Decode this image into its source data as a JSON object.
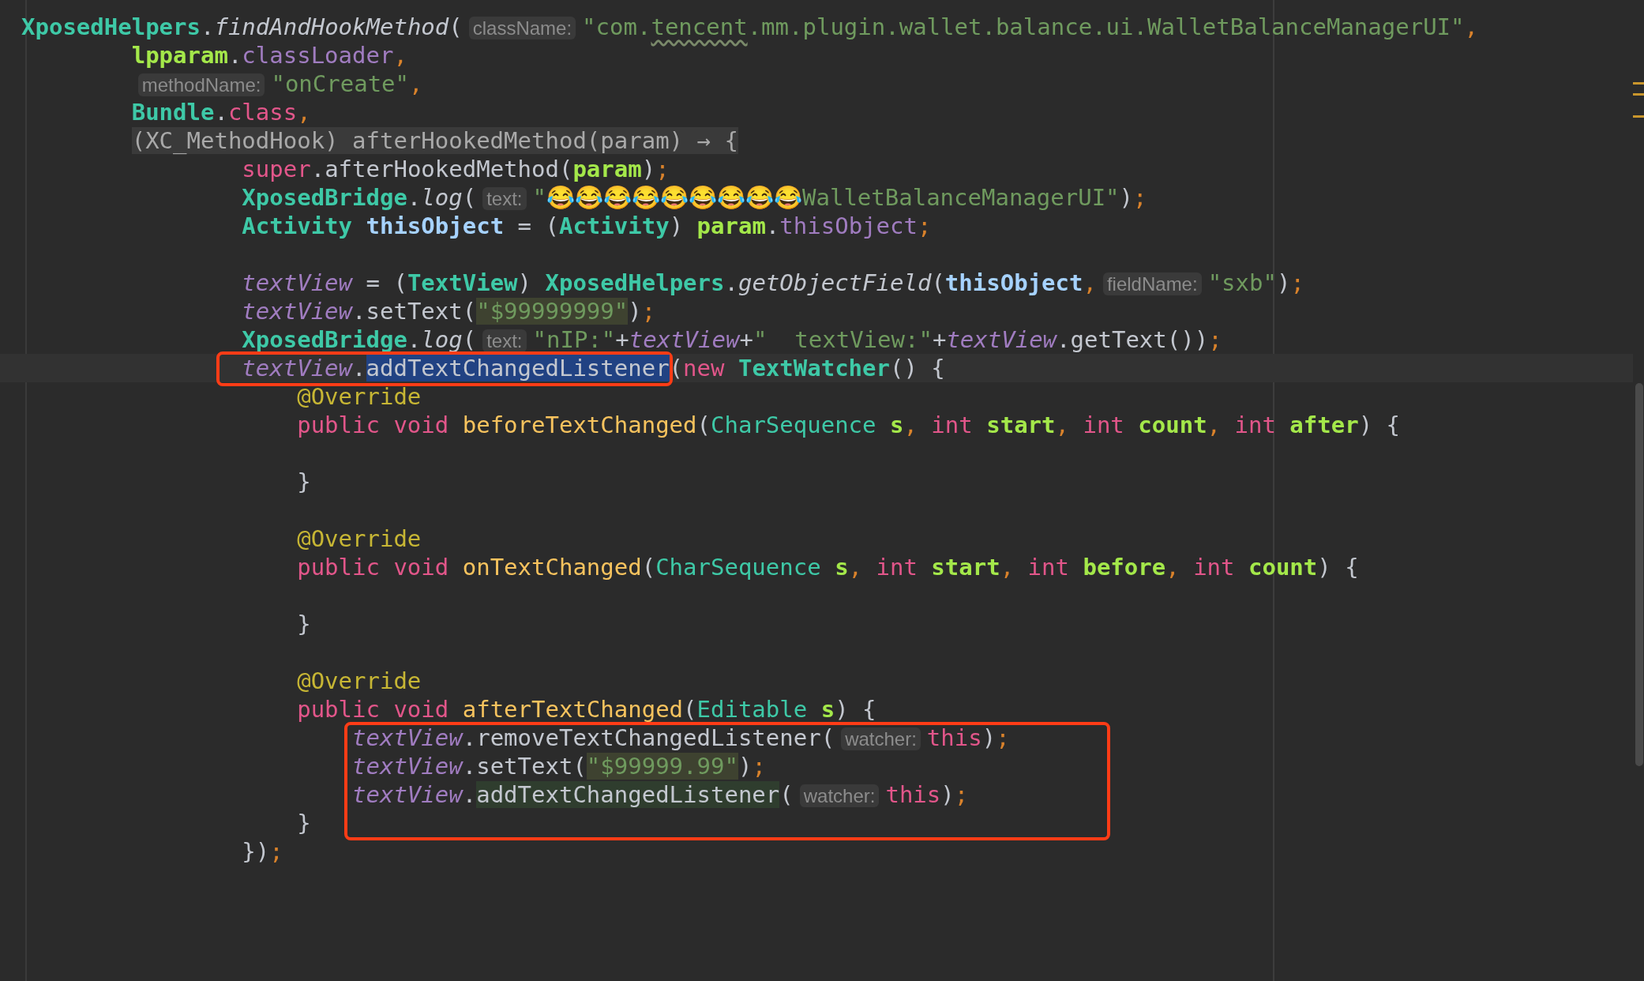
{
  "editor": {
    "lines": [
      {
        "kind": "line",
        "tokens": [
          {
            "kind": "class",
            "text": "XposedHelpers"
          },
          {
            "kind": "punct",
            "text": "."
          },
          {
            "kind": "static-call",
            "text": "findAndHookMethod"
          },
          {
            "kind": "punct",
            "text": "("
          },
          {
            "kind": "hint",
            "text": "className:"
          },
          {
            "kind": "string",
            "text": "\"com."
          },
          {
            "kind": "string-typo",
            "text": "tencent"
          },
          {
            "kind": "string",
            "text": ".mm.plugin.wallet.balance.ui.WalletBalanceManagerUI\""
          },
          {
            "kind": "sep",
            "text": ","
          }
        ],
        "children": [
          {
            "kind": "line",
            "tokens": [
              {
                "kind": "param",
                "text": "lpparam"
              },
              {
                "kind": "punct",
                "text": "."
              },
              {
                "kind": "field",
                "text": "classLoader"
              },
              {
                "kind": "sep",
                "text": ","
              }
            ]
          },
          {
            "kind": "line",
            "tokens": [
              {
                "kind": "hint",
                "text": "methodName:"
              },
              {
                "kind": "string",
                "text": "\"onCreate\""
              },
              {
                "kind": "sep",
                "text": ","
              }
            ]
          },
          {
            "kind": "line",
            "tokens": [
              {
                "kind": "class",
                "text": "Bundle"
              },
              {
                "kind": "punct",
                "text": "."
              },
              {
                "kind": "keyword",
                "text": "class"
              },
              {
                "kind": "sep",
                "text": ","
              }
            ]
          },
          {
            "kind": "line",
            "tokens": [
              {
                "kind": "folded",
                "text": "(XC_MethodHook) afterHookedMethod(param) → {"
              }
            ],
            "children": [
              {
                "kind": "line",
                "tokens": [
                  {
                    "kind": "keyword",
                    "text": "super"
                  },
                  {
                    "kind": "punct",
                    "text": "."
                  },
                  {
                    "kind": "call",
                    "text": "afterHookedMethod"
                  },
                  {
                    "kind": "punct",
                    "text": "("
                  },
                  {
                    "kind": "param",
                    "text": "param"
                  },
                  {
                    "kind": "punct",
                    "text": ")"
                  },
                  {
                    "kind": "sep",
                    "text": ";"
                  }
                ]
              },
              {
                "kind": "line",
                "tokens": [
                  {
                    "kind": "class",
                    "text": "XposedBridge"
                  },
                  {
                    "kind": "punct",
                    "text": "."
                  },
                  {
                    "kind": "static-call",
                    "text": "log"
                  },
                  {
                    "kind": "punct",
                    "text": "("
                  },
                  {
                    "kind": "hint",
                    "text": "text:"
                  },
                  {
                    "kind": "string",
                    "text": "\"😂😂😂😂😂😂😂😂😂WalletBalanceManagerUI\""
                  },
                  {
                    "kind": "punct",
                    "text": ")"
                  },
                  {
                    "kind": "sep",
                    "text": ";"
                  }
                ]
              },
              {
                "kind": "line",
                "tokens": [
                  {
                    "kind": "class",
                    "text": "Activity"
                  },
                  {
                    "kind": "local",
                    "text": " thisObject"
                  },
                  {
                    "kind": "punct",
                    "text": " = ("
                  },
                  {
                    "kind": "class",
                    "text": "Activity"
                  },
                  {
                    "kind": "punct",
                    "text": ")"
                  },
                  {
                    "kind": "param",
                    "text": " param"
                  },
                  {
                    "kind": "punct",
                    "text": "."
                  },
                  {
                    "kind": "field",
                    "text": "thisObject"
                  },
                  {
                    "kind": "sep",
                    "text": ";"
                  }
                ]
              },
              {
                "kind": "blank"
              },
              {
                "kind": "line",
                "tokens": [
                  {
                    "kind": "static-field",
                    "text": "textView"
                  },
                  {
                    "kind": "punct",
                    "text": " = ("
                  },
                  {
                    "kind": "class",
                    "text": "TextView"
                  },
                  {
                    "kind": "punct",
                    "text": ")"
                  },
                  {
                    "kind": "class",
                    "text": " XposedHelpers"
                  },
                  {
                    "kind": "punct",
                    "text": "."
                  },
                  {
                    "kind": "static-call",
                    "text": "getObjectField"
                  },
                  {
                    "kind": "punct",
                    "text": "("
                  },
                  {
                    "kind": "local",
                    "text": "thisObject"
                  },
                  {
                    "kind": "sep",
                    "text": ","
                  },
                  {
                    "kind": "hint",
                    "text": "fieldName:"
                  },
                  {
                    "kind": "string",
                    "text": "\"sxb\""
                  },
                  {
                    "kind": "punct",
                    "text": ")"
                  },
                  {
                    "kind": "sep",
                    "text": ";"
                  }
                ]
              },
              {
                "kind": "line",
                "tokens": [
                  {
                    "kind": "static-field",
                    "text": "textView"
                  },
                  {
                    "kind": "punct",
                    "text": "."
                  },
                  {
                    "kind": "call",
                    "text": "setText"
                  },
                  {
                    "kind": "punct",
                    "text": "("
                  },
                  {
                    "kind": "string-match",
                    "text": "\"$99999999\""
                  },
                  {
                    "kind": "punct",
                    "text": ")"
                  },
                  {
                    "kind": "sep",
                    "text": ";"
                  }
                ]
              },
              {
                "kind": "line",
                "tokens": [
                  {
                    "kind": "class",
                    "text": "XposedBridge"
                  },
                  {
                    "kind": "punct",
                    "text": "."
                  },
                  {
                    "kind": "static-call",
                    "text": "log"
                  },
                  {
                    "kind": "punct",
                    "text": "("
                  },
                  {
                    "kind": "hint",
                    "text": "text:"
                  },
                  {
                    "kind": "string",
                    "text": "\"nIP:\""
                  },
                  {
                    "kind": "punct",
                    "text": "+"
                  },
                  {
                    "kind": "static-field",
                    "text": "textView"
                  },
                  {
                    "kind": "punct",
                    "text": "+"
                  },
                  {
                    "kind": "string",
                    "text": "\"  textView:\""
                  },
                  {
                    "kind": "punct",
                    "text": "+"
                  },
                  {
                    "kind": "static-field",
                    "text": "textView"
                  },
                  {
                    "kind": "punct",
                    "text": "."
                  },
                  {
                    "kind": "call",
                    "text": "getText"
                  },
                  {
                    "kind": "punct",
                    "text": "())"
                  },
                  {
                    "kind": "sep",
                    "text": ";"
                  }
                ]
              },
              {
                "kind": "line",
                "current": true,
                "tokens": [
                  {
                    "kind": "callout",
                    "tokens": [
                      {
                        "kind": "static-field",
                        "text": "textView"
                      },
                      {
                        "kind": "punct",
                        "text": "."
                      },
                      {
                        "kind": "selected-call",
                        "text": "addTextChangedListener"
                      }
                    ]
                  },
                  {
                    "kind": "punct",
                    "text": "("
                  },
                  {
                    "kind": "keyword",
                    "text": "new"
                  },
                  {
                    "kind": "class",
                    "text": " TextWatcher"
                  },
                  {
                    "kind": "punct",
                    "text": "() {"
                  }
                ],
                "children": [
                  {
                    "kind": "line",
                    "tokens": [
                      {
                        "kind": "annotation",
                        "text": "@Override"
                      }
                    ]
                  },
                  {
                    "kind": "line",
                    "tokens": [
                      {
                        "kind": "keyword",
                        "text": "public void"
                      },
                      {
                        "kind": "decl",
                        "text": " beforeTextChanged"
                      },
                      {
                        "kind": "punct",
                        "text": "("
                      },
                      {
                        "kind": "type",
                        "text": "CharSequence"
                      },
                      {
                        "kind": "param",
                        "text": " s"
                      },
                      {
                        "kind": "sep",
                        "text": ","
                      },
                      {
                        "kind": "keyword",
                        "text": " int"
                      },
                      {
                        "kind": "param",
                        "text": " start"
                      },
                      {
                        "kind": "sep",
                        "text": ","
                      },
                      {
                        "kind": "keyword",
                        "text": " int"
                      },
                      {
                        "kind": "param",
                        "text": " count"
                      },
                      {
                        "kind": "sep",
                        "text": ","
                      },
                      {
                        "kind": "keyword",
                        "text": " int"
                      },
                      {
                        "kind": "param",
                        "text": " after"
                      },
                      {
                        "kind": "punct",
                        "text": ") {"
                      }
                    ]
                  },
                  {
                    "kind": "blank"
                  },
                  {
                    "kind": "line",
                    "tokens": [
                      {
                        "kind": "punct",
                        "text": "}"
                      }
                    ]
                  },
                  {
                    "kind": "blank"
                  },
                  {
                    "kind": "line",
                    "tokens": [
                      {
                        "kind": "annotation",
                        "text": "@Override"
                      }
                    ]
                  },
                  {
                    "kind": "line",
                    "tokens": [
                      {
                        "kind": "keyword",
                        "text": "public void"
                      },
                      {
                        "kind": "decl",
                        "text": " onTextChanged"
                      },
                      {
                        "kind": "punct",
                        "text": "("
                      },
                      {
                        "kind": "type",
                        "text": "CharSequence"
                      },
                      {
                        "kind": "param",
                        "text": " s"
                      },
                      {
                        "kind": "sep",
                        "text": ","
                      },
                      {
                        "kind": "keyword",
                        "text": " int"
                      },
                      {
                        "kind": "param",
                        "text": " start"
                      },
                      {
                        "kind": "sep",
                        "text": ","
                      },
                      {
                        "kind": "keyword",
                        "text": " int"
                      },
                      {
                        "kind": "param",
                        "text": " before"
                      },
                      {
                        "kind": "sep",
                        "text": ","
                      },
                      {
                        "kind": "keyword",
                        "text": " int"
                      },
                      {
                        "kind": "param",
                        "text": " count"
                      },
                      {
                        "kind": "punct",
                        "text": ") {"
                      }
                    ]
                  },
                  {
                    "kind": "blank"
                  },
                  {
                    "kind": "line",
                    "tokens": [
                      {
                        "kind": "punct",
                        "text": "}"
                      }
                    ]
                  },
                  {
                    "kind": "blank"
                  },
                  {
                    "kind": "line",
                    "tokens": [
                      {
                        "kind": "annotation",
                        "text": "@Override"
                      }
                    ]
                  },
                  {
                    "kind": "line",
                    "tokens": [
                      {
                        "kind": "keyword",
                        "text": "public void"
                      },
                      {
                        "kind": "decl",
                        "text": " afterTextChanged"
                      },
                      {
                        "kind": "punct",
                        "text": "("
                      },
                      {
                        "kind": "type",
                        "text": "Editable"
                      },
                      {
                        "kind": "param",
                        "text": " s"
                      },
                      {
                        "kind": "punct",
                        "text": ") {"
                      }
                    ],
                    "children": [
                      {
                        "kind": "callout",
                        "children": [
                          {
                            "kind": "line",
                            "tokens": [
                              {
                                "kind": "static-field",
                                "text": "textView"
                              },
                              {
                                "kind": "punct",
                                "text": "."
                              },
                              {
                                "kind": "call",
                                "text": "removeTextChangedListener"
                              },
                              {
                                "kind": "punct",
                                "text": "("
                              },
                              {
                                "kind": "hint",
                                "text": "watcher:"
                              },
                              {
                                "kind": "keyword",
                                "text": "this"
                              },
                              {
                                "kind": "punct",
                                "text": ")"
                              },
                              {
                                "kind": "sep",
                                "text": ";"
                              }
                            ]
                          },
                          {
                            "kind": "line",
                            "tokens": [
                              {
                                "kind": "static-field",
                                "text": "textView"
                              },
                              {
                                "kind": "punct",
                                "text": "."
                              },
                              {
                                "kind": "call",
                                "text": "setText"
                              },
                              {
                                "kind": "punct",
                                "text": "("
                              },
                              {
                                "kind": "string-match",
                                "text": "\"$99999.99\""
                              },
                              {
                                "kind": "punct",
                                "text": ")"
                              },
                              {
                                "kind": "sep",
                                "text": ";"
                              }
                            ]
                          },
                          {
                            "kind": "line",
                            "tokens": [
                              {
                                "kind": "static-field",
                                "text": "textView"
                              },
                              {
                                "kind": "punct",
                                "text": "."
                              },
                              {
                                "kind": "usage-call",
                                "text": "addTextChangedListener"
                              },
                              {
                                "kind": "punct",
                                "text": "("
                              },
                              {
                                "kind": "hint",
                                "text": "watcher:"
                              },
                              {
                                "kind": "keyword",
                                "text": "this"
                              },
                              {
                                "kind": "punct",
                                "text": ")"
                              },
                              {
                                "kind": "sep",
                                "text": ";"
                              }
                            ]
                          }
                        ]
                      }
                    ]
                  },
                  {
                    "kind": "line",
                    "tokens": [
                      {
                        "kind": "punct",
                        "text": "}"
                      }
                    ]
                  }
                ]
              },
              {
                "kind": "line",
                "tokens": [
                  {
                    "kind": "punct",
                    "text": "})"
                  },
                  {
                    "kind": "sep",
                    "text": ";"
                  }
                ]
              }
            ]
          }
        ]
      }
    ]
  }
}
